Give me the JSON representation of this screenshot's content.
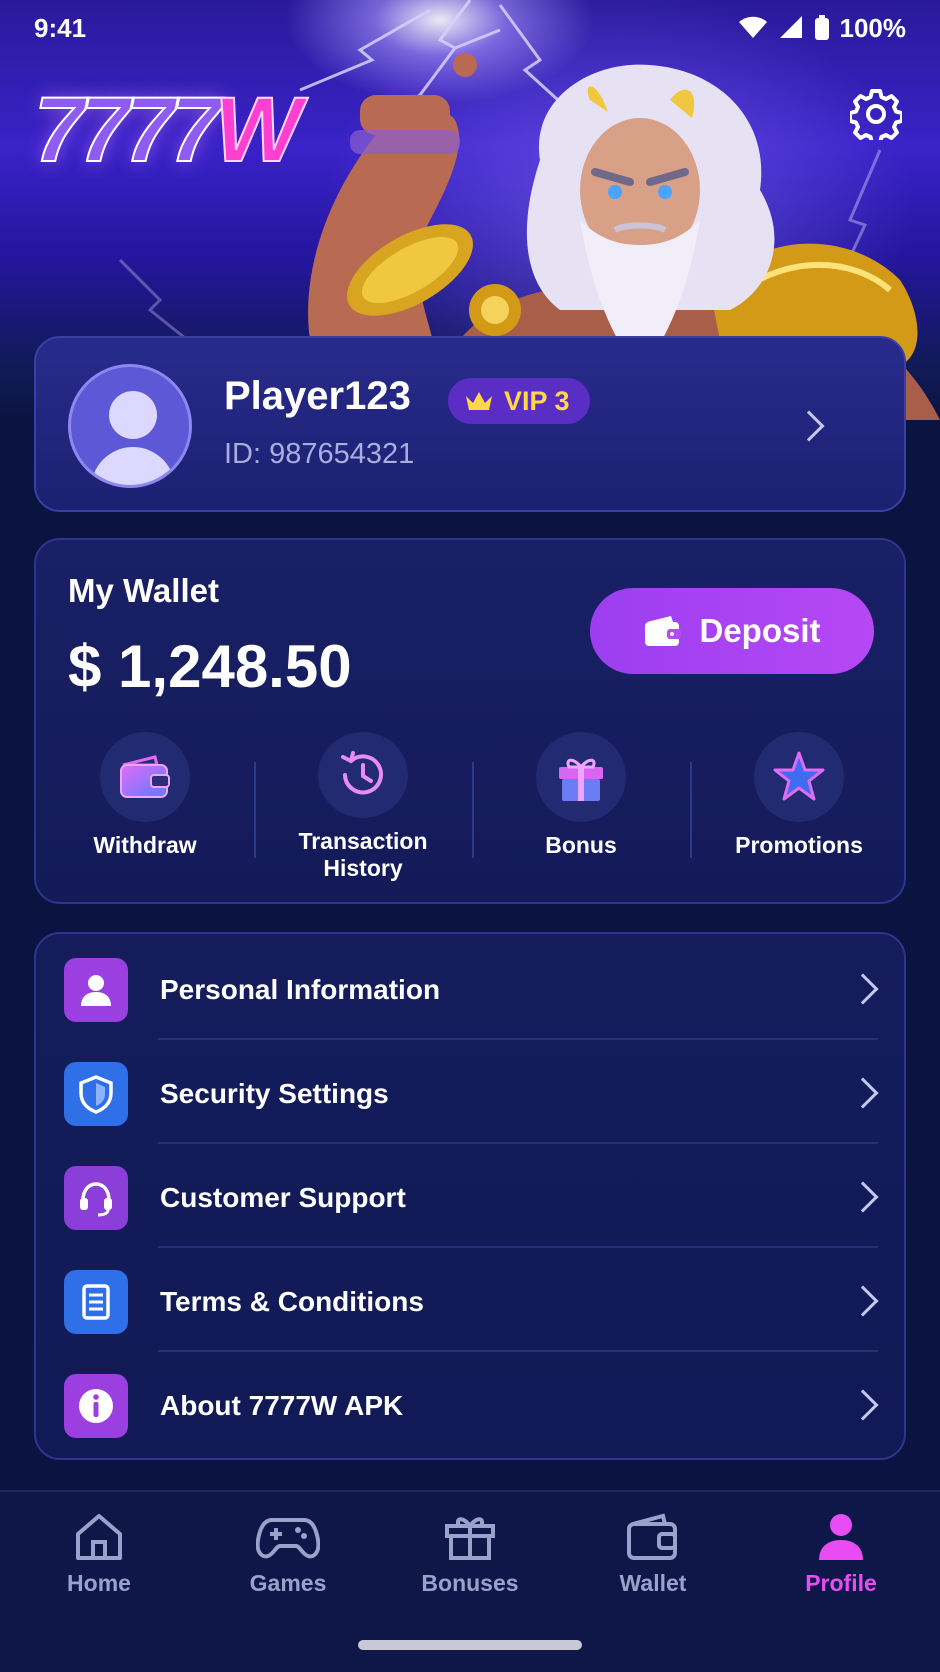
{
  "status_bar": {
    "time": "9:41",
    "battery": "100%"
  },
  "brand": {
    "logo_digits": "7777",
    "logo_letter": "W"
  },
  "profile": {
    "name": "Player123",
    "vip": "VIP 3",
    "id": "ID: 987654321"
  },
  "wallet": {
    "title": "My Wallet",
    "balance": "$ 1,248.50",
    "deposit_label": "Deposit",
    "actions": [
      {
        "label": "Withdraw",
        "icon": "wallet-icon"
      },
      {
        "label": "Transaction History",
        "icon": "history-icon"
      },
      {
        "label": "Bonus",
        "icon": "gift-icon"
      },
      {
        "label": "Promotions",
        "icon": "star-icon"
      }
    ]
  },
  "menu": [
    {
      "label": "Personal Information",
      "icon": "user-icon",
      "color": "#9b3fe0"
    },
    {
      "label": "Security Settings",
      "icon": "shield-icon",
      "color": "#2f6fe8"
    },
    {
      "label": "Customer Support",
      "icon": "headset-icon",
      "color": "#8b3fd8"
    },
    {
      "label": "Terms & Conditions",
      "icon": "document-icon",
      "color": "#2f6fe8"
    },
    {
      "label": "About 7777W APK",
      "icon": "info-icon",
      "color": "#9b3fe0"
    }
  ],
  "nav": [
    {
      "label": "Home",
      "icon": "home-icon"
    },
    {
      "label": "Games",
      "icon": "gamepad-icon"
    },
    {
      "label": "Bonuses",
      "icon": "gift-icon"
    },
    {
      "label": "Wallet",
      "icon": "wallet-icon"
    },
    {
      "label": "Profile",
      "icon": "profile-icon",
      "active": true
    }
  ],
  "colors": {
    "accent": "#b648f5",
    "active_nav": "#e84cf2",
    "vip_gold": "#ffd84a"
  }
}
